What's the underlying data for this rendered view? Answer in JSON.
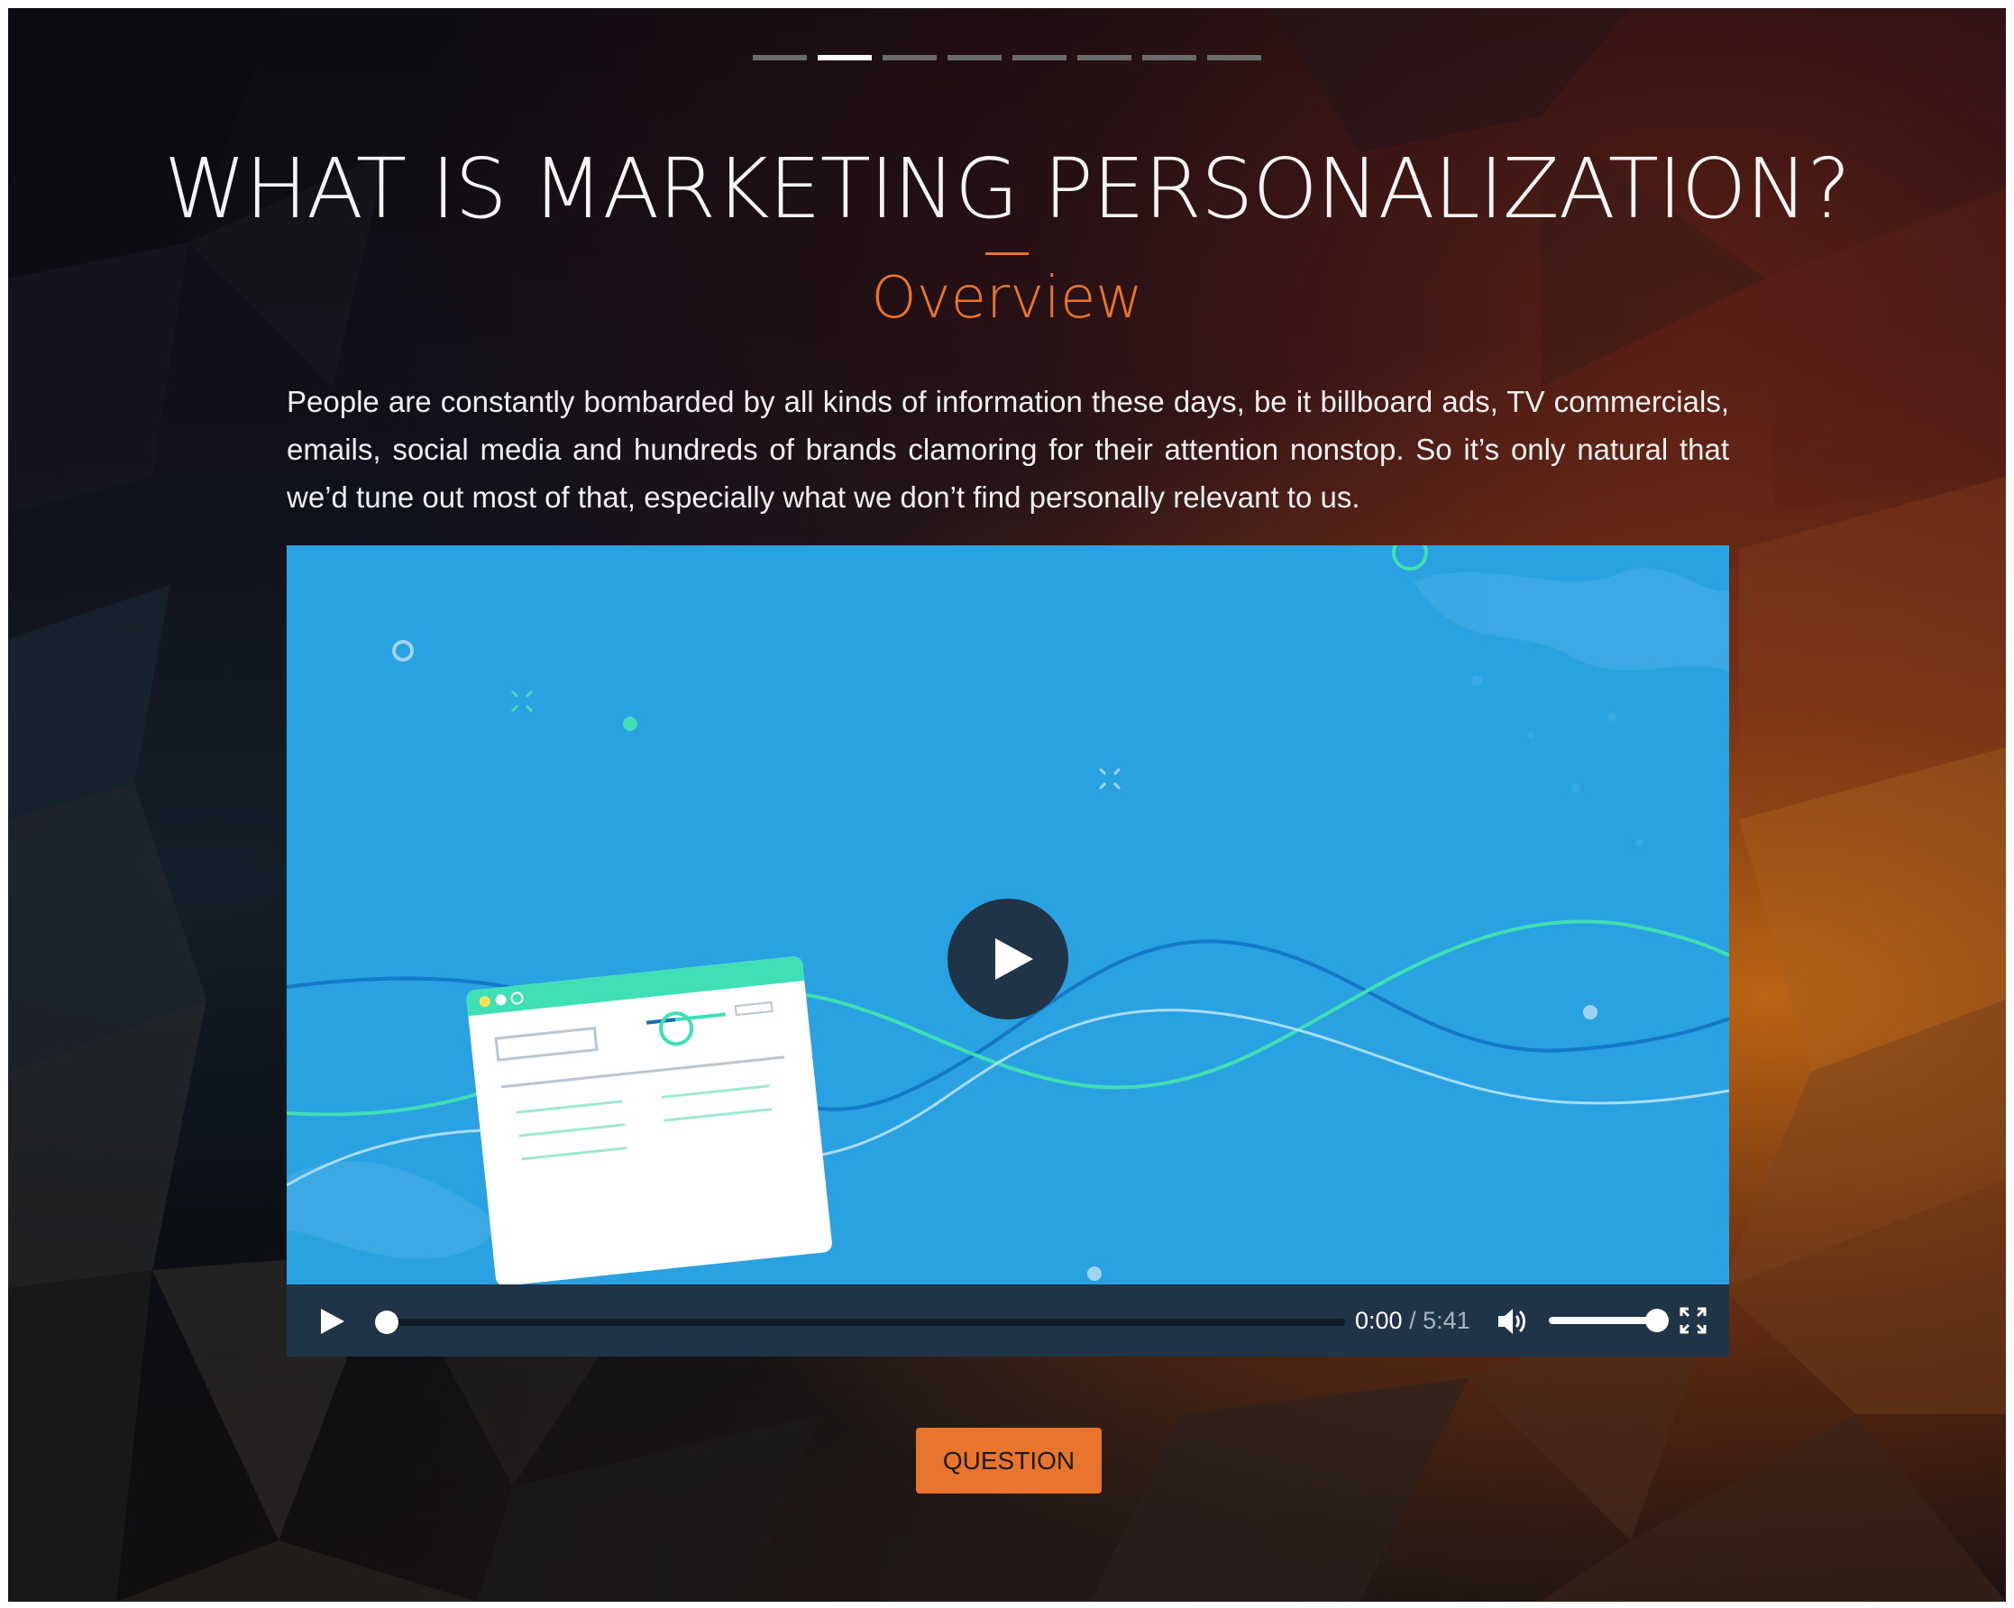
{
  "progress": {
    "total_steps": 8,
    "current_step": 2
  },
  "title": "WHAT IS MARKETING PERSONALIZATION?",
  "subtitle": "Overview",
  "intro": "People are constantly bombarded by all kinds of information these days, be it billboard ads, TV commercials, emails, social media and hundreds of brands clamoring for their attention nonstop. So it’s only natural that we’d tune out most of that, especially what we don’t find personally relevant to us.",
  "video": {
    "big_play_icon": "play-icon",
    "controls": {
      "play_icon": "play-icon",
      "current_time": "0:00",
      "separator": " / ",
      "duration": "5:41",
      "progress_fraction": 0.0,
      "volume_icon": "speaker-icon",
      "volume_fraction": 1.0,
      "fullscreen_icon": "fullscreen-icon"
    }
  },
  "question_button": "QUESTION",
  "colors": {
    "accent": "#e8742d",
    "video_background": "#2aa1e0",
    "control_bar": "#1f3446"
  }
}
